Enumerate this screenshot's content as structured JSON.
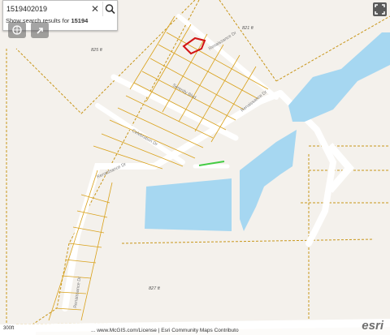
{
  "search": {
    "value": "1519402019",
    "clear_glyph": "✕"
  },
  "suggestion": {
    "prefix": "Show search results for ",
    "query": "15194"
  },
  "map": {
    "elevation_labels": [
      "821 ft",
      "825 ft",
      "827 ft"
    ],
    "streets": [
      "Renaissance Dr",
      "Serenity Blvd",
      "Renaissance Dr",
      "Celebration Dr",
      "Renaissance Dr",
      "Renaissance Dr"
    ],
    "scale_label": "300ft"
  },
  "attribution": {
    "text": "... www.McGIS.com/License | Esri Community Maps Contributo",
    "logo": "esri"
  },
  "icons": {
    "search": "search-icon",
    "clear": "close-icon",
    "expand": "expand-icon",
    "basemap": "basemap-icon",
    "locate": "locate-icon",
    "next": "chevron-right-icon"
  },
  "colors": {
    "parcel_line": "#d9a11a",
    "parcel_dash": "#b98a14",
    "road": "#ffffff",
    "water": "#a6d7f1",
    "background": "#f4f1ec",
    "highlight": "#d21414",
    "green_line": "#44cc44"
  }
}
